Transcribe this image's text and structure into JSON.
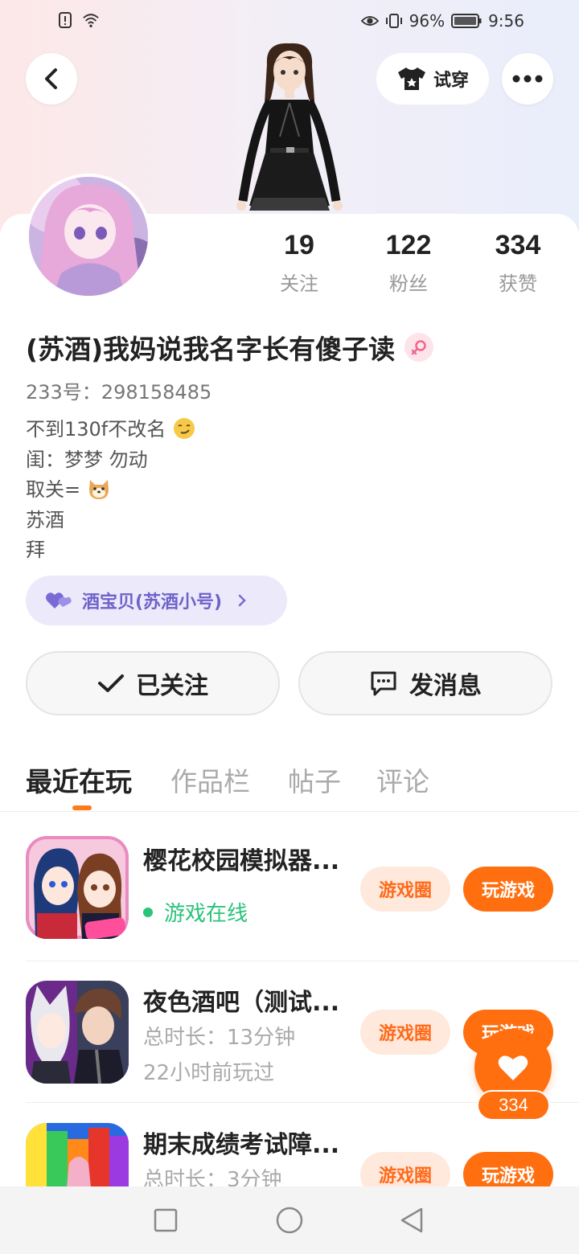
{
  "status_bar": {
    "battery": "96%",
    "time": "9:56"
  },
  "header": {
    "tryon_label": "试穿"
  },
  "profile": {
    "nickname": "(苏酒)我妈说我名字长有傻子读",
    "uid": "233号：298158485",
    "stats": [
      {
        "num": "19",
        "label": "关注"
      },
      {
        "num": "122",
        "label": "粉丝"
      },
      {
        "num": "334",
        "label": "获赞"
      }
    ],
    "bio": {
      "line1": "不到130f不改名",
      "line2": "闺：梦梦 勿动",
      "line3": "取关=",
      "line4": "苏酒",
      "line5": "拜"
    },
    "alt_account": "酒宝贝(苏酒小号)"
  },
  "actions": {
    "follow_label": "已关注",
    "message_label": "发消息"
  },
  "tabs": [
    "最近在玩",
    "作品栏",
    "帖子",
    "评论"
  ],
  "games": [
    {
      "title": "樱花校园模拟器...",
      "status": "游戏在线",
      "circle_label": "游戏圈",
      "play_label": "玩游戏"
    },
    {
      "title": "夜色酒吧（测试...",
      "duration": "总时长：13分钟",
      "last_played": "22小时前玩过",
      "circle_label": "游戏圈",
      "play_label": "玩游戏"
    },
    {
      "title": "期末成绩考试障...",
      "duration": "总时长：3分钟",
      "circle_label": "游戏圈",
      "play_label": "玩游戏"
    }
  ],
  "like_count": "334",
  "colors": {
    "accent": "#ff6f0f",
    "accent_light": "#fee9dc",
    "online": "#2ac37a",
    "alt_pill_bg": "#ece9fb",
    "alt_pill_text": "#6e63c9"
  }
}
